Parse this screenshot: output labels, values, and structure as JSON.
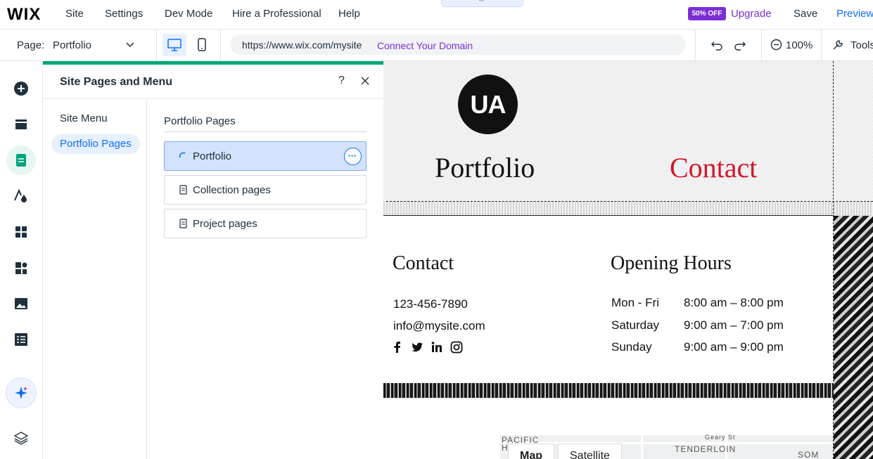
{
  "topbar": {
    "logo": "WIX",
    "menu": [
      "Site",
      "Settings",
      "Dev Mode",
      "Hire a Professional",
      "Help"
    ],
    "collapse_glyph": "˄",
    "sale_badge": "50% OFF",
    "upgrade": "Upgrade",
    "save": "Save",
    "preview": "Preview"
  },
  "toolbar": {
    "page_label": "Page:",
    "page_value": "Portfolio",
    "url": "https://www.wix.com/mysite",
    "connect_domain": "Connect Your Domain",
    "zoom": "100%",
    "tools": "Tools"
  },
  "rail": {
    "icons": [
      "add-icon",
      "menus-icon",
      "pages-icon",
      "design-icon",
      "apps-icon",
      "business-icon",
      "media-icon",
      "cms-icon",
      "ai-icon",
      "layers-icon"
    ]
  },
  "panel": {
    "title": "Site Pages and Menu",
    "help": "?",
    "nav": [
      "Site Menu",
      "Portfolio Pages"
    ],
    "pages_heading": "Portfolio Pages",
    "pages": [
      "Portfolio",
      "Collection pages",
      "Project pages"
    ]
  },
  "site": {
    "logo_text": "UA",
    "header_links": [
      "Portfolio",
      "Contact"
    ],
    "contact_heading": "Contact",
    "phone": "123-456-7890",
    "email": "info@mysite.com",
    "hours_heading": "Opening Hours",
    "hours": [
      {
        "day": "Mon - Fri",
        "time": "8:00 am – 8:00 pm"
      },
      {
        "day": "Saturday",
        "time": "9:00 am – 7:00 pm"
      },
      {
        "day": "Sunday",
        "time": "9:00 am – 9:00 pm"
      }
    ],
    "map": {
      "tabs": [
        "Map",
        "Satellite"
      ],
      "labels": [
        "PACIFIC",
        "TENDERLOIN",
        "SOM",
        "Geary St",
        "H"
      ]
    }
  },
  "colors": {
    "accent_blue": "#116dff",
    "upgrade_purple": "#7b2fd5",
    "panel_green": "#00a57b",
    "contact_red": "#d1162a"
  }
}
